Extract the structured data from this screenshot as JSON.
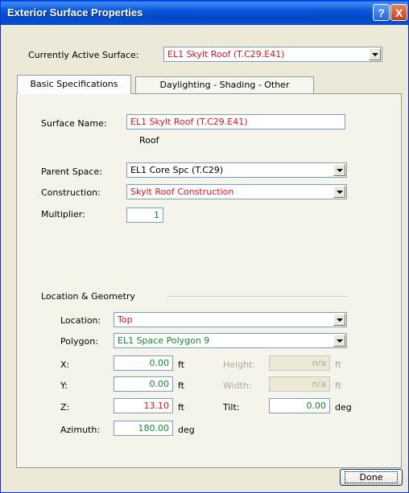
{
  "window": {
    "title": "Exterior Surface Properties",
    "help_glyph": "?",
    "close_glyph": "X"
  },
  "active_surface": {
    "label": "Currently Active Surface:",
    "value": "EL1 Skylt Roof (T.C29.E41)"
  },
  "tabs": [
    {
      "label": "Basic Specifications",
      "active": true
    },
    {
      "label": "Daylighting  -  Shading  -  Other",
      "active": false
    }
  ],
  "basic": {
    "surface_name_label": "Surface Name:",
    "surface_name_value": "EL1 Skylt Roof (T.C29.E41)",
    "surface_type": "Roof",
    "parent_space_label": "Parent Space:",
    "parent_space_value": "EL1 Core Spc (T.C29)",
    "construction_label": "Construction:",
    "construction_value": "Skylt Roof Construction",
    "multiplier_label": "Multiplier:",
    "multiplier_value": "1"
  },
  "geometry": {
    "group_label": "Location & Geometry",
    "location_label": "Location:",
    "location_value": "Top",
    "polygon_label": "Polygon:",
    "polygon_value": "EL1 Space Polygon 9",
    "x_label": "X:",
    "x_value": "0.00",
    "x_unit": "ft",
    "y_label": "Y:",
    "y_value": "0.00",
    "y_unit": "ft",
    "z_label": "Z:",
    "z_value": "13.10",
    "z_unit": "ft",
    "azimuth_label": "Azimuth:",
    "azimuth_value": "180.00",
    "azimuth_unit": "deg",
    "height_label": "Height:",
    "height_value": "n/a",
    "height_unit": "ft",
    "width_label": "Width:",
    "width_value": "n/a",
    "width_unit": "ft",
    "tilt_label": "Tilt:",
    "tilt_value": "0.00",
    "tilt_unit": "deg"
  },
  "done_label": "Done",
  "colors": {
    "default_value": "#e0161c",
    "user_value": "#14892c",
    "titlebar": "#0049c8"
  }
}
